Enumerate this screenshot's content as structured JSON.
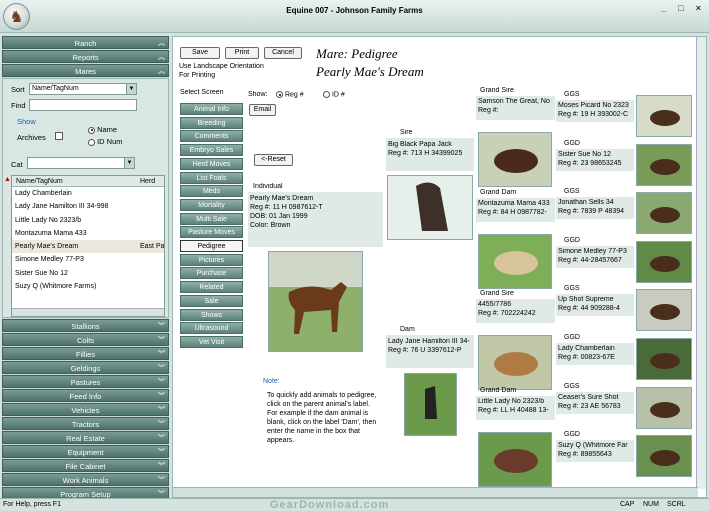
{
  "window": {
    "title": "Equine 007 - Johnson Family Farms",
    "controls": [
      "_",
      "□",
      "×"
    ]
  },
  "nav_top": [
    "Ranch",
    "Reports",
    "Mares"
  ],
  "mares_panel": {
    "sort_label": "Sort",
    "sort_value": "Name/TagNum",
    "find_label": "Find",
    "show_label": "Show",
    "archives_label": "Archives",
    "radio_name": "Name",
    "radio_id": "ID Num",
    "cat_label": "Cat",
    "list_headers": [
      "Name/TagNum",
      "Herd"
    ],
    "list_items": [
      {
        "name": "Lady Chamberlain",
        "herd": ""
      },
      {
        "name": "Lady Jane Hamilton III 34-998",
        "herd": ""
      },
      {
        "name": "Little Lady No 2323/b",
        "herd": ""
      },
      {
        "name": "Montazuma Mama 433",
        "herd": ""
      },
      {
        "name": "Pearly Mae's Dream",
        "herd": "East Pa"
      },
      {
        "name": "Simone Medley 77-P3",
        "herd": ""
      },
      {
        "name": "Sister Sue No 12",
        "herd": ""
      },
      {
        "name": "Suzy Q (Whitmore Farms)",
        "herd": ""
      }
    ]
  },
  "nav_bottom": [
    "Stallions",
    "Colts",
    "Fillies",
    "Geldings",
    "Pastures",
    "Feed Info",
    "Vehicles",
    "Tractors",
    "Real Estate",
    "Equipment",
    "File Cabinet",
    "Work Animals",
    "Program Setup"
  ],
  "toolbar": {
    "save": "Save",
    "print": "Print",
    "cancel": "Cancel",
    "hint": "Use Landscape Orientation\nFor Printing"
  },
  "heading": {
    "line1": "Mare: Pedigree",
    "line2": "Pearly Mae's Dream"
  },
  "select_screen_label": "Select Screen",
  "screens": [
    "Animal Info",
    "Breeding",
    "Comments",
    "Embryo Sales",
    "Herd Moves",
    "List Foals",
    "Meds",
    "Mortality",
    "Multi Sale",
    "Pasture Moves",
    "Pedigree",
    "Pictures",
    "Purchase",
    "Related",
    "Sale",
    "Shows",
    "Ultrasound",
    "Vet Visit"
  ],
  "active_screen": "Pedigree",
  "show": {
    "label": "Show:",
    "reg": "Reg #",
    "id": "ID #"
  },
  "email_label": "Email",
  "reset_label": "<-Reset",
  "individual": {
    "label": "Individual",
    "lines": [
      "Pearly Mae's Dream",
      "Reg #: 11 H 0987612-T",
      "DOB: 01 Jan 1999",
      "Color: Brown"
    ]
  },
  "note": {
    "label": "Note:",
    "text": "To quickly add animals to pedigree, click on the parent animal's label. For example if the dam animal is blank, click on the label 'Dam', then enter the name in the box that appears."
  },
  "sire": {
    "label": "Sire",
    "name": "Big Black Papa Jack",
    "reg": "Reg #: 713 H 34399025"
  },
  "dam": {
    "label": "Dam",
    "name": "Lady Jane Hamilton III 34-",
    "reg": "Reg #: 76 U 3397612-P"
  },
  "grand": [
    {
      "label": "Grand Sire",
      "name": "Samson The Great, No",
      "reg": "Reg #:"
    },
    {
      "label": "Grand Dam",
      "name": "Montazuma Mama 433",
      "reg": "Reg #: 84 H 0987782-"
    },
    {
      "label": "Grand Sire",
      "name": "4455/7786",
      "reg": "Reg #: 702224242"
    },
    {
      "label": "Grand Dam",
      "name": "Little Lady No 2323/b",
      "reg": "Reg #: LL H 40488 13-"
    }
  ],
  "great": [
    {
      "label": "GGS",
      "name": "Moses Picard No 2323",
      "reg": "Reg #: 19 H 393002-C"
    },
    {
      "label": "GGD",
      "name": "Sister Sue No 12",
      "reg": "Reg #: 23 98653245"
    },
    {
      "label": "GGS",
      "name": "Jonathan Sells 34",
      "reg": "Reg #: 7839 P 48394"
    },
    {
      "label": "GGD",
      "name": "Simone Medley 77-P3",
      "reg": "Reg #: 44-28457667"
    },
    {
      "label": "GGS",
      "name": "Up Shot Supreme",
      "reg": "Reg #: 44 909288-4"
    },
    {
      "label": "GGD",
      "name": "Lady Chamberlain",
      "reg": "Reg #: 00823-67E"
    },
    {
      "label": "GGS",
      "name": "Ceaser's Sure Shot",
      "reg": "Reg #: 23 AE 56783"
    },
    {
      "label": "GGD",
      "name": "Suzy Q (Whitmore Far",
      "reg": "Reg #: 89855643"
    }
  ],
  "status": {
    "help": "For Help, press F1",
    "cap": "CAP",
    "num": "NUM",
    "scrl": "SCRL"
  },
  "watermark": "GearDownload.com"
}
